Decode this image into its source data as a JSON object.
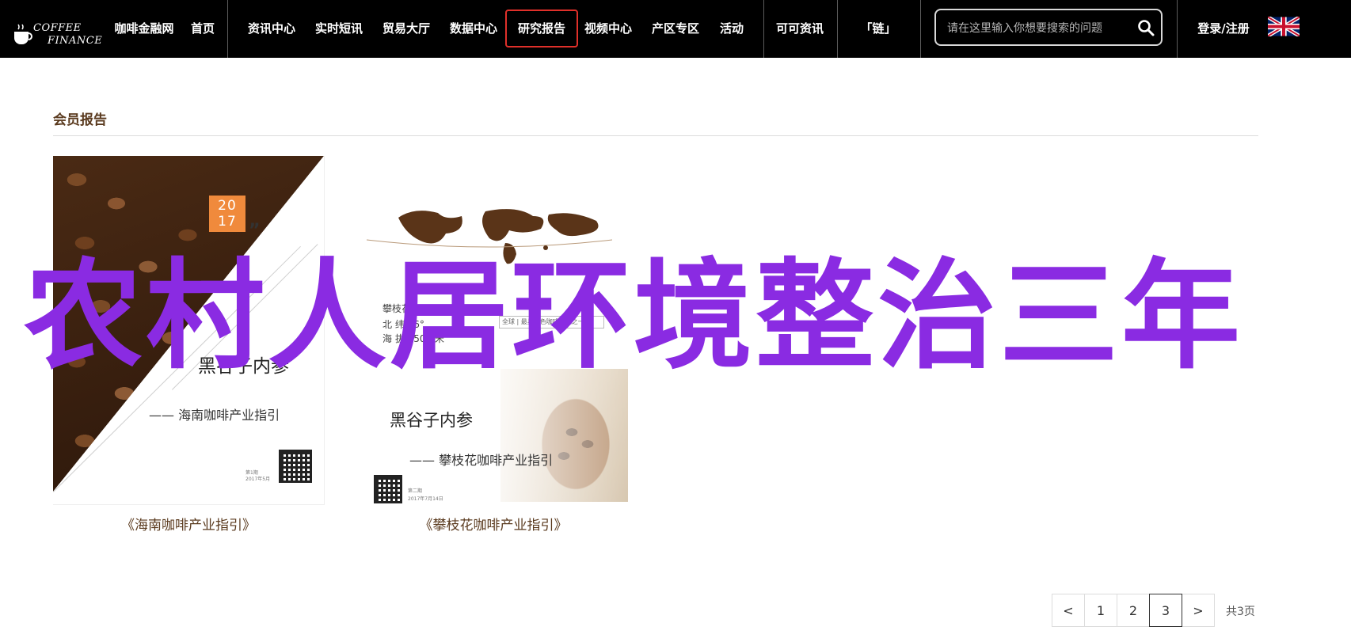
{
  "header": {
    "logo": {
      "line1": "COFFEE",
      "line2": "FINANCE"
    },
    "site_name": "咖啡金融网",
    "nav": [
      {
        "label": "首页"
      },
      {
        "label": "资讯中心"
      },
      {
        "label": "实时短讯"
      },
      {
        "label": "贸易大厅"
      },
      {
        "label": "数据中心"
      },
      {
        "label": "研究报告",
        "active": true
      },
      {
        "label": "视频中心"
      },
      {
        "label": "产区专区"
      },
      {
        "label": "活动"
      },
      {
        "label": "可可资讯"
      },
      {
        "label": "「链」"
      }
    ],
    "search": {
      "placeholder": "请在这里输入你想要搜索的问题"
    },
    "login_label": "登录/注册",
    "language_icon": "uk-flag-icon",
    "colors": {
      "bar": "#000000",
      "active_border": "#e0302a"
    }
  },
  "section": {
    "title": "会员报告"
  },
  "reports": [
    {
      "caption": "《海南咖啡产业指引》",
      "cover": {
        "year_top": "20",
        "year_bottom": "17",
        "quote_mark": "”",
        "title": "黑谷子内参",
        "subtitle": "—— 海南咖啡产业指引",
        "issue": "第1期",
        "date": "2017年5月"
      }
    },
    {
      "caption": "《攀枝花咖啡产业指引》",
      "cover": {
        "place": "攀枝花",
        "lat": "北 纬 26°",
        "alt": "海 拔 1500 米",
        "tag": "全球 | 最具特色咖啡产区之一",
        "title": "黑谷子内参",
        "subtitle": "—— 攀枝花咖啡产业指引",
        "issue": "第二期",
        "date": "2017年7月14日"
      }
    }
  ],
  "overlay_headline": "农村人居环境整治三年",
  "pagination": {
    "prev": "<",
    "pages": [
      "1",
      "2",
      "3"
    ],
    "current": "3",
    "next": ">",
    "total_label": "共3页"
  }
}
